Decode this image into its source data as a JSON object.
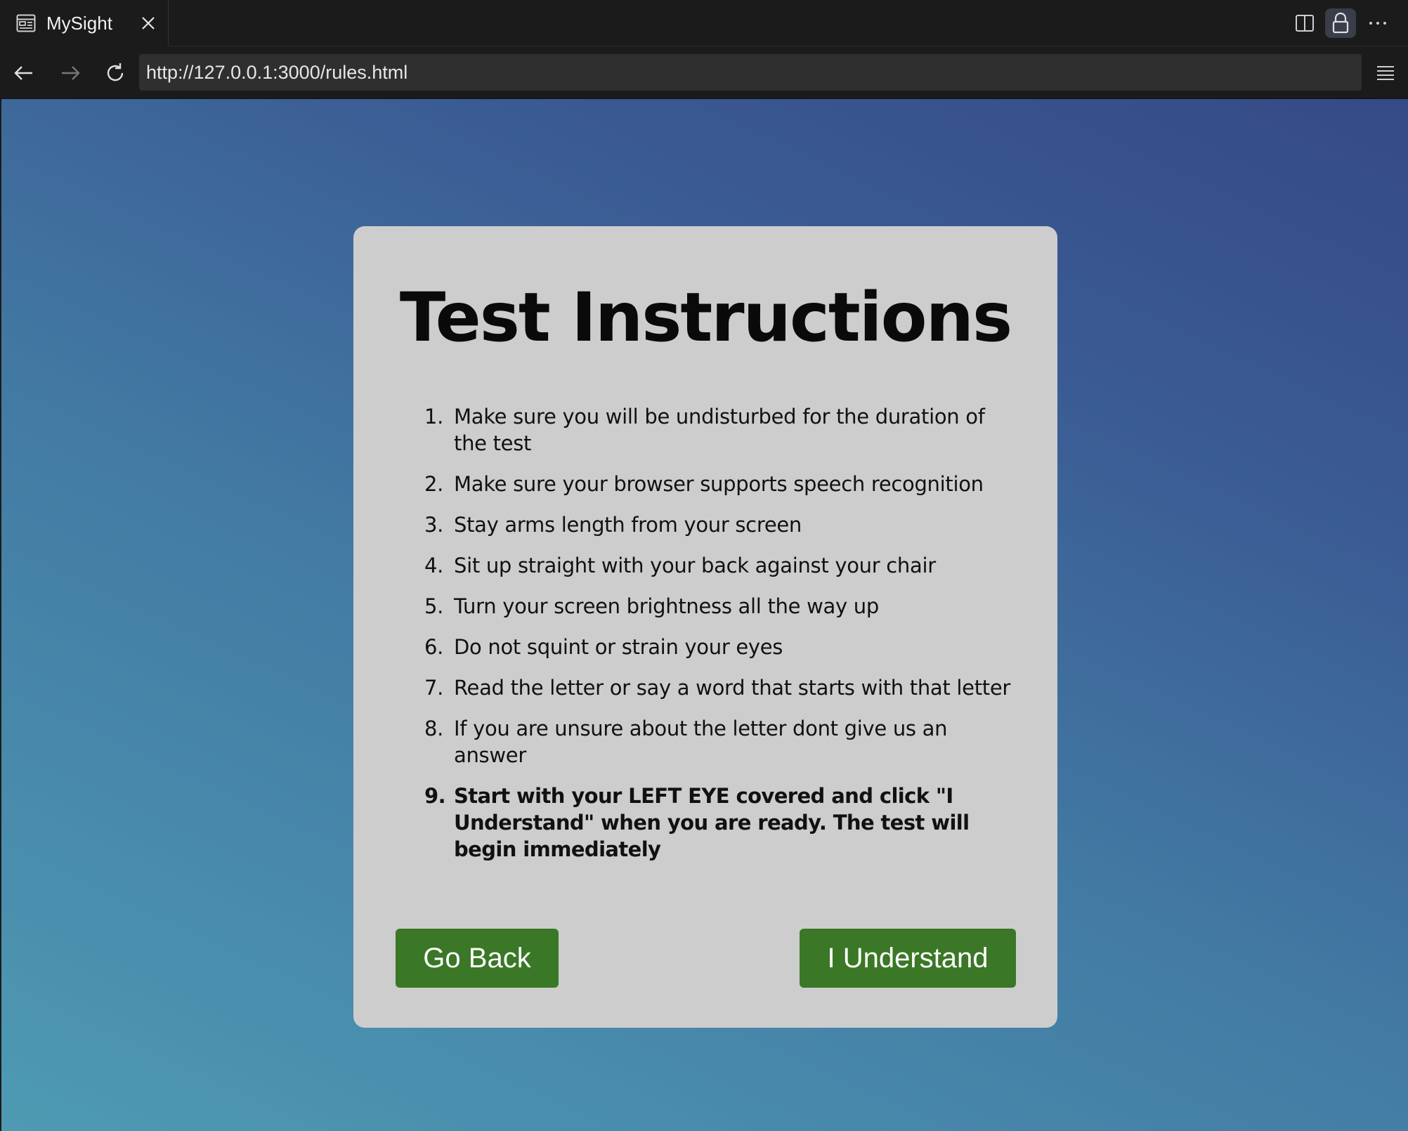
{
  "browser": {
    "tab": {
      "title": "MySight",
      "icon": "reader-icon"
    },
    "url": "http://127.0.0.1:3000/rules.html",
    "toolbar_icons": [
      "split-screen-icon",
      "lock-icon",
      "more-icon",
      "menu-icon"
    ],
    "nav_icons": [
      "back-arrow-icon",
      "forward-arrow-icon",
      "reload-icon"
    ]
  },
  "page": {
    "title": "Test Instructions",
    "rules": [
      {
        "num": "1.",
        "text": "Make sure you will be undisturbed for the duration of the test"
      },
      {
        "num": "2.",
        "text": "Make sure your browser supports speech recognition"
      },
      {
        "num": "3.",
        "text": "Stay arms length from your screen"
      },
      {
        "num": "4.",
        "text": "Sit up straight with your back against your chair"
      },
      {
        "num": "5.",
        "text": "Turn your screen brightness all the way up"
      },
      {
        "num": "6.",
        "text": "Do not squint or strain your eyes"
      },
      {
        "num": "7.",
        "text": "Read the letter or say a word that starts with that letter"
      },
      {
        "num": "8.",
        "text": "If you are unsure about the letter dont give us an answer"
      },
      {
        "num": "9.",
        "text": "Start with your LEFT EYE covered and click \"I Understand\" when you are ready. The test will begin immediately"
      }
    ],
    "buttons": {
      "back": "Go Back",
      "understand": "I Understand"
    },
    "colors": {
      "button_bg": "#3a7726",
      "card_bg": "#cdcdcd",
      "gradient_top_right": "#354a86",
      "gradient_bottom_left": "#4e9ab3"
    }
  }
}
